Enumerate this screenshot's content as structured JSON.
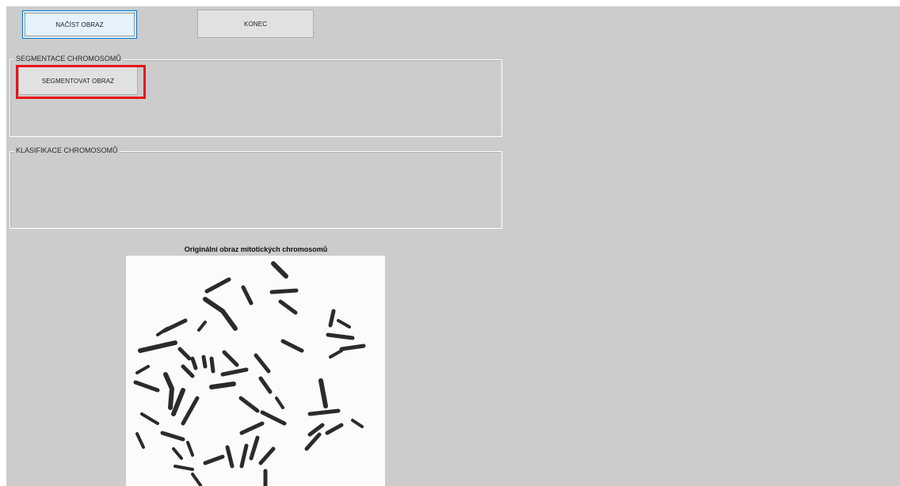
{
  "window": {
    "background_color": "#cccccc"
  },
  "toolbar": {
    "load_label": "NAČÍST OBRAZ",
    "end_label": "KONEC"
  },
  "segmentation_panel": {
    "title": "SEGMENTACE CHROMOSOMŮ",
    "segment_button_label": "SEGMENTOVAT OBRAZ",
    "highlight_color": "#e8141c"
  },
  "classification_panel": {
    "title": "KLASIFIKACE CHROMOSOMŮ"
  },
  "image_view": {
    "title": "Originální obraz mitotických chromosomů",
    "content": "karyotype-chromosome-image"
  }
}
